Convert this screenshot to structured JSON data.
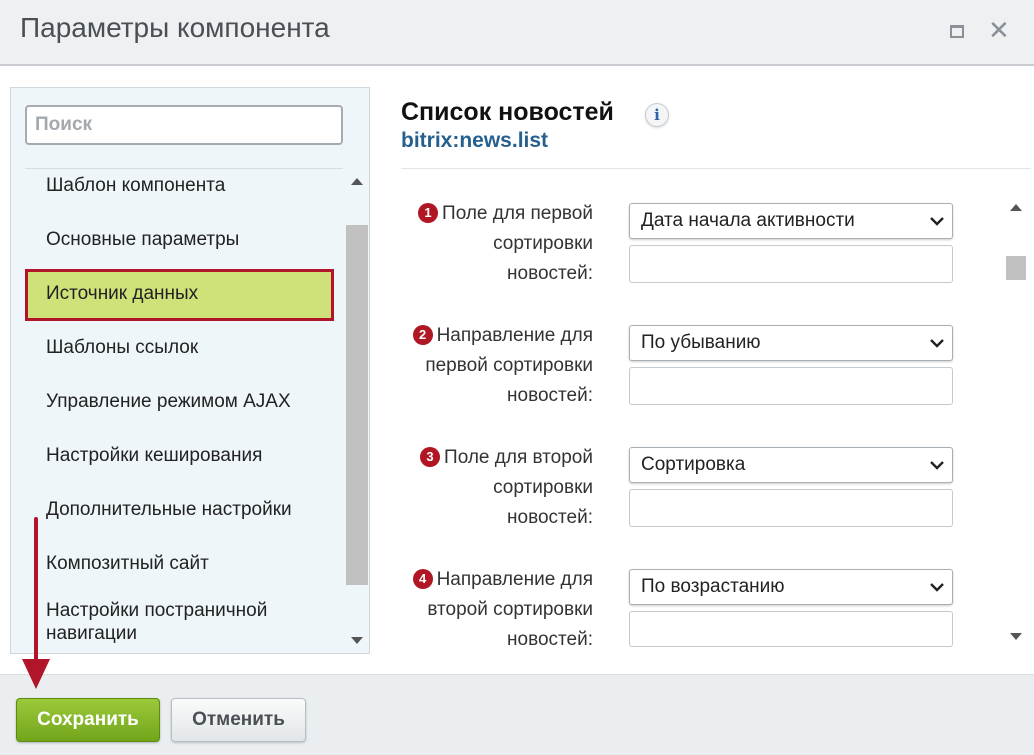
{
  "window": {
    "title": "Параметры компонента"
  },
  "sidebar": {
    "search_placeholder": "Поиск",
    "items": [
      {
        "label": "Шаблон компонента"
      },
      {
        "label": "Основные параметры"
      },
      {
        "label": "Источник данных",
        "active": true
      },
      {
        "label": "Шаблоны ссылок"
      },
      {
        "label": "Управление режимом AJAX"
      },
      {
        "label": "Настройки кеширования"
      },
      {
        "label": "Дополнительные настройки"
      },
      {
        "label": "Композитный сайт"
      },
      {
        "label_line1": "Настройки постраничной",
        "label_line2": "навигации"
      }
    ]
  },
  "component": {
    "title": "Список новостей",
    "code": "bitrix:news.list",
    "info_icon_glyph": "i"
  },
  "params": [
    {
      "num": "1",
      "label_line1": "Поле для первой",
      "label_line2": "сортировки",
      "label_line3": "новостей:",
      "value": "Дата начала активности",
      "extra_value": ""
    },
    {
      "num": "2",
      "label_line1": "Направление для",
      "label_line2": "первой сортировки",
      "label_line3": "новостей:",
      "value": "По убыванию",
      "extra_value": ""
    },
    {
      "num": "3",
      "label_line1": "Поле для второй",
      "label_line2": "сортировки",
      "label_line3": "новостей:",
      "value": "Сортировка",
      "extra_value": ""
    },
    {
      "num": "4",
      "label_line1": "Направление для",
      "label_line2": "второй сортировки",
      "label_line3": "новостей:",
      "value": "По возрастанию",
      "extra_value": ""
    }
  ],
  "footer": {
    "save_label": "Сохранить",
    "cancel_label": "Отменить"
  },
  "colors": {
    "active_item_bg": "#cfe27a",
    "active_item_border": "#b0152a",
    "save_button": "#80b12a",
    "badge": "#b01624",
    "component_code": "#27608f"
  }
}
